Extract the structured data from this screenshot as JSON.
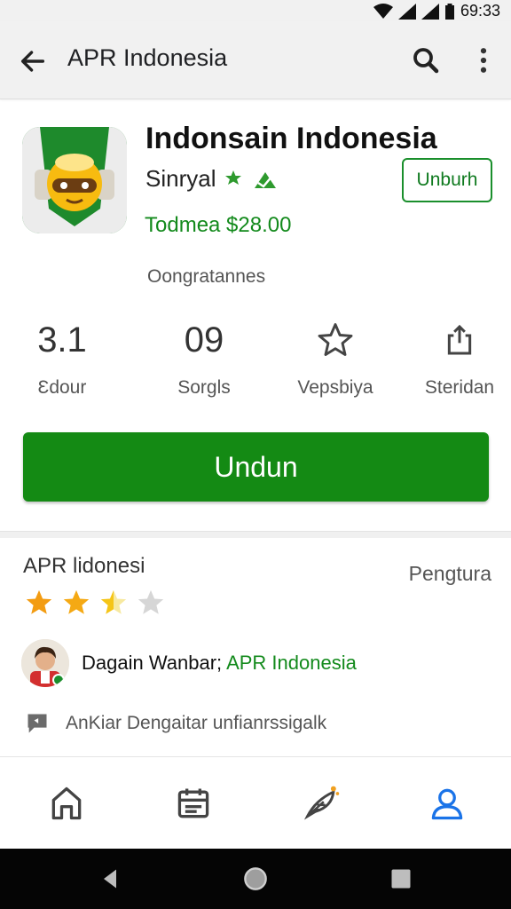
{
  "status_bar": {
    "time": "69:33"
  },
  "app_bar": {
    "title": "APR Indonesia"
  },
  "app": {
    "name": "Indonsain Indonesia",
    "developer": "Sinryal",
    "price": "Todmea $28.00",
    "install_small_label": "Unburh",
    "sub_label": "Oongratannes"
  },
  "stats": [
    {
      "value": "3.1",
      "label": "Ɛdour"
    },
    {
      "value": "09",
      "label": "Sorgls"
    },
    {
      "icon": "star-outline-icon",
      "label": "Vepsbiya"
    },
    {
      "icon": "share-icon",
      "label": "Steridan"
    }
  ],
  "main_install_label": "Undun",
  "review": {
    "title": "APR lidonesi",
    "side_label": "Pengtura",
    "rating_stars": 2.5,
    "rating_max": 5,
    "user_name": "Dagain Wanbar;",
    "user_app": "APR Indonesia",
    "comment": "AnKiar Dengaitar unfianrssigalk"
  },
  "bottom_nav": [
    "home-icon",
    "calendar-icon",
    "feather-icon",
    "profile-icon"
  ],
  "colors": {
    "accent_green": "#148a14",
    "nav_active": "#1a73e8"
  }
}
